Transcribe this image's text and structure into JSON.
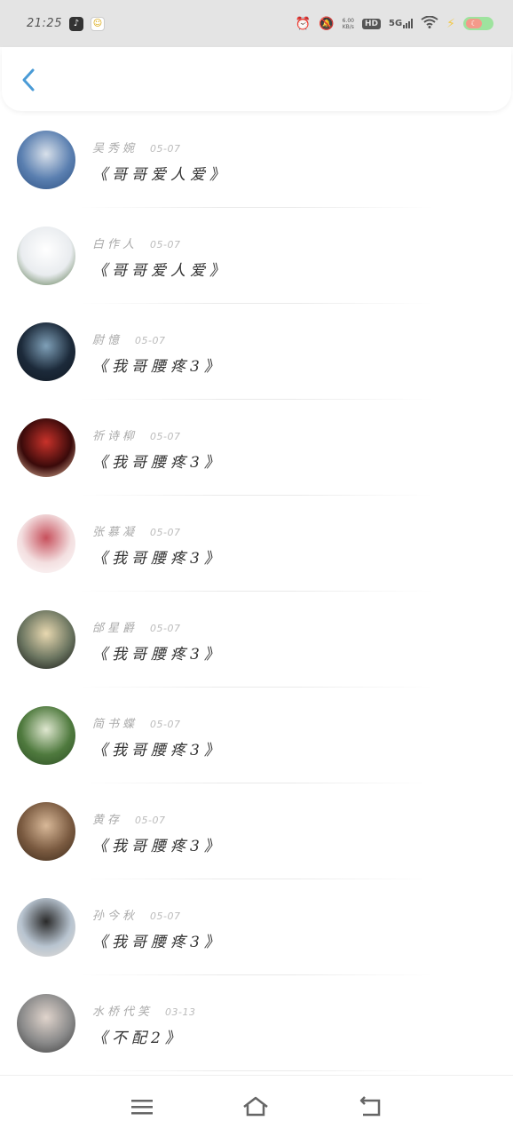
{
  "status_bar": {
    "time": "21:25",
    "net_speed_value": "6.00",
    "net_speed_unit": "KB/s",
    "hd_label": "HD",
    "network_label": "5G"
  },
  "header": {
    "back_icon": "chevron-left-icon"
  },
  "list": {
    "items": [
      {
        "name": "吴秀婉",
        "date": "05-07",
        "title": "《哥哥爱人爱》",
        "avatar_colors": [
          "#5a7fb0",
          "#d8e0ea",
          "#2c4f80"
        ]
      },
      {
        "name": "白作人",
        "date": "05-07",
        "title": "《哥哥爱人爱》",
        "avatar_colors": [
          "#e9ecef",
          "#ffffff",
          "#4a6b3c"
        ]
      },
      {
        "name": "尉憶",
        "date": "05-07",
        "title": "《我哥腰疼3》",
        "avatar_colors": [
          "#1c2a3a",
          "#7fa0b8",
          "#0e1620"
        ]
      },
      {
        "name": "祈诗柳",
        "date": "05-07",
        "title": "《我哥腰疼3》",
        "avatar_colors": [
          "#3a0a0a",
          "#c8322a",
          "#f1c7a8"
        ]
      },
      {
        "name": "张慕凝",
        "date": "05-07",
        "title": "《我哥腰疼3》",
        "avatar_colors": [
          "#f3dfe0",
          "#c7505c",
          "#ffffff"
        ]
      },
      {
        "name": "邰星爵",
        "date": "05-07",
        "title": "《我哥腰疼3》",
        "avatar_colors": [
          "#6b7560",
          "#e8d8b0",
          "#111111"
        ]
      },
      {
        "name": "简书蝶",
        "date": "05-07",
        "title": "《我哥腰疼3》",
        "avatar_colors": [
          "#4f7a3e",
          "#dfe7d0",
          "#2a4a22"
        ]
      },
      {
        "name": "黄存",
        "date": "05-07",
        "title": "《我哥腰疼3》",
        "avatar_colors": [
          "#7a5a40",
          "#d8b898",
          "#3a2818"
        ]
      },
      {
        "name": "孙今秋",
        "date": "05-07",
        "title": "《我哥腰疼3》",
        "avatar_colors": [
          "#b8c4d0",
          "#2a2a2a",
          "#e8e0d8"
        ]
      },
      {
        "name": "水桥代笑",
        "date": "03-13",
        "title": "《不配2》",
        "avatar_colors": [
          "#8a8a8a",
          "#e0d4cc",
          "#3a3a3a"
        ]
      }
    ]
  },
  "nav": {
    "menu_icon": "menu-icon",
    "home_icon": "home-icon",
    "back_icon": "back-icon"
  },
  "colors": {
    "accent": "#4a9bd6",
    "status_bar_bg": "#e4e4e4",
    "title_text": "#333333",
    "meta_text": "#aaaaaa"
  }
}
